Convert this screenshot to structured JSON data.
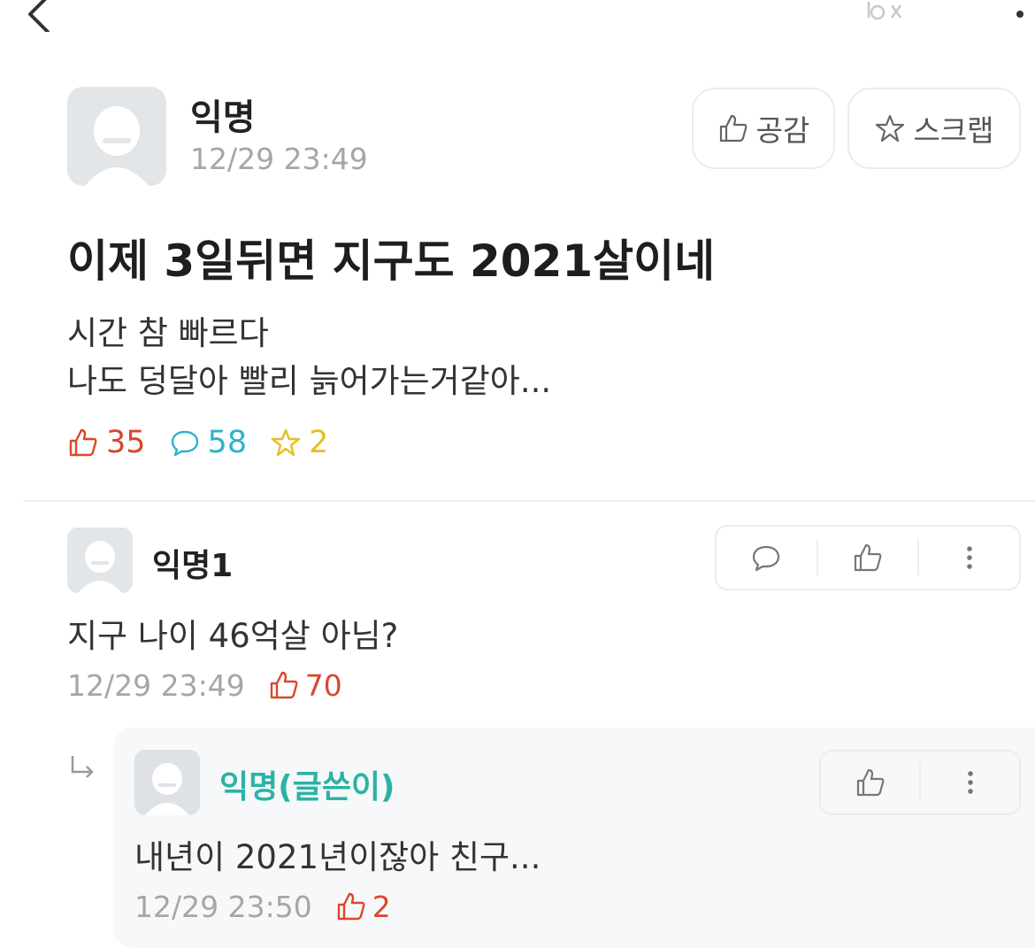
{
  "post": {
    "author": "익명",
    "time": "12/29 23:49",
    "like_button_label": "공감",
    "scrap_button_label": "스크랩",
    "title": "이제 3일뒤면 지구도 2021살이네",
    "body_lines": [
      "시간 참 빠르다",
      "나도 덩달아 빨리 늙어가는거같아..."
    ],
    "stats": {
      "likes": "35",
      "comments": "58",
      "scraps": "2"
    }
  },
  "comments": [
    {
      "author": "익명1",
      "text": "지구 나이 46억살 아님?",
      "time": "12/29 23:49",
      "likes": "70"
    }
  ],
  "replies": [
    {
      "author": "익명(글쓴이)",
      "text": "내년이 2021년이잖아 친구...",
      "time": "12/29 23:50",
      "likes": "2"
    }
  ],
  "colors": {
    "like": "#d9472c",
    "comment": "#2bb3c8",
    "scrap": "#e6c022",
    "op_author": "#2ab3a6",
    "muted": "#a6a6a6"
  },
  "icons": {
    "back": "chevron-left-icon",
    "more": "vertical-dots-icon",
    "like": "thumbs-up-icon",
    "comment": "speech-bubble-icon",
    "scrap": "star-icon",
    "reply": "reply-arrow-icon"
  }
}
